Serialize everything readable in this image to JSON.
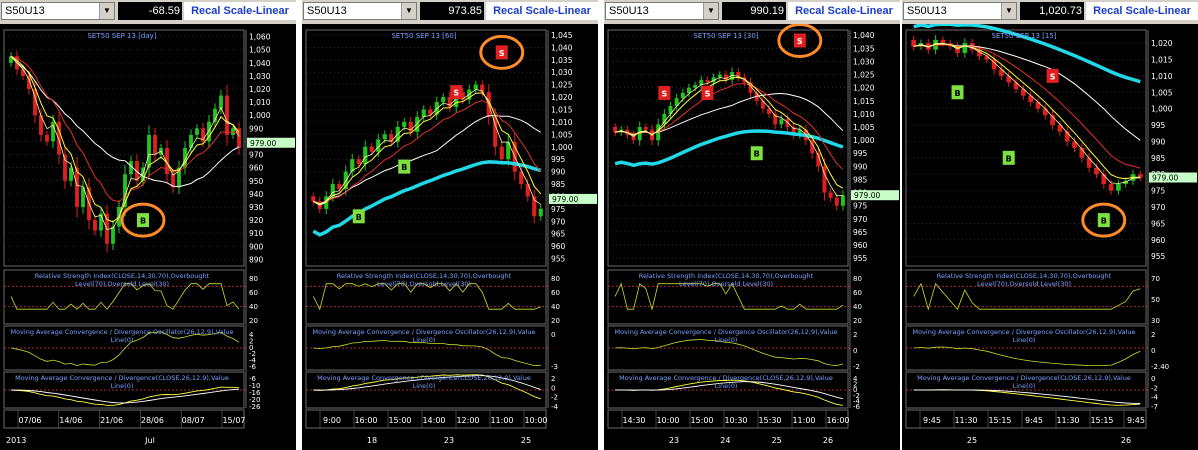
{
  "panels": [
    {
      "symbol": "S50U13",
      "value": "-68.59",
      "recal": "Recal Scale-Linear",
      "title": "SET50 SEP 13  [day]",
      "price_ticks": [
        "1,060",
        "1,050",
        "1,040",
        "1,030",
        "1,020",
        "1,010",
        "1,000",
        "990",
        "980",
        "970",
        "960",
        "950",
        "940",
        "930",
        "920",
        "910",
        "900",
        "890"
      ],
      "price_tag": "979.00",
      "rsi_label": [
        "Relative Strength Index(CLOSE,14,30,70),Overbought",
        "Level(70),Oversold Level(30)"
      ],
      "rsi_ticks": [
        "80",
        "60",
        "40",
        "20"
      ],
      "osc_label": [
        "Moving Average Convergence / Divergence Oscillator(26,12,9),Value",
        "Line(0)"
      ],
      "osc_ticks": [
        "4",
        "2",
        "0",
        "-2",
        "-4",
        "-6"
      ],
      "macd_label": [
        "Moving Average Convergence / Divergence(CLOSE,26,12,9),Value",
        "Line(0)"
      ],
      "macd_ticks": [
        "-6",
        "-10",
        "-16",
        "-20",
        "-26"
      ],
      "date_ticks": [
        "07/06",
        "14/06",
        "21/06",
        "28/06",
        "08/07",
        "15/07"
      ],
      "period_labels": [
        "Jul"
      ],
      "corner_label": "2013",
      "signals": [
        {
          "type": "B",
          "label": "B",
          "circled": true
        }
      ]
    },
    {
      "symbol": "S50U13",
      "value": "973.85",
      "recal": "Recal Scale-Linear",
      "title": "SET50 SEP 13  [60]",
      "price_ticks": [
        "1,045",
        "1,040",
        "1,035",
        "1,030",
        "1,025",
        "1,020",
        "1,015",
        "1,010",
        "1,005",
        "1,000",
        "995",
        "990",
        "985",
        "980",
        "975",
        "970",
        "965",
        "960",
        "955"
      ],
      "price_tag": "979.00",
      "rsi_label": [
        "Relative Strength Index(CLOSE,14,30,70),Overbought",
        "Level(70),Oversold Level(30)"
      ],
      "rsi_ticks": [
        "80",
        "60",
        "40",
        "20"
      ],
      "osc_label": [
        "Moving Average Convergence / Divergence Oscillator(26,12,9),Value",
        "Line(0)"
      ],
      "osc_ticks": [
        "0",
        "-3"
      ],
      "macd_label": [
        "Moving Average Convergence / Divergence(CLOSE,26,12,9),Value",
        "Line(0)"
      ],
      "macd_ticks": [
        "2",
        "0",
        "-2",
        "-4"
      ],
      "date_ticks": [
        "9:00",
        "16:00",
        "15:00",
        "14:00",
        "12:00",
        "11:00",
        "10:00"
      ],
      "period_labels": [
        "18",
        "23",
        "25"
      ],
      "corner_label": "",
      "signals": [
        {
          "type": "B",
          "label": "B"
        },
        {
          "type": "B",
          "label": "B"
        },
        {
          "type": "S",
          "label": "S"
        },
        {
          "type": "S",
          "label": "S",
          "circled": true
        }
      ]
    },
    {
      "symbol": "S50U13",
      "value": "990.19",
      "recal": "Recal Scale-Linear",
      "title": "SET50 SEP 13  [30]",
      "price_ticks": [
        "1,040",
        "1,035",
        "1,030",
        "1,025",
        "1,020",
        "1,015",
        "1,010",
        "1,005",
        "1,000",
        "995",
        "990",
        "985",
        "980",
        "975",
        "970",
        "965",
        "960",
        "955"
      ],
      "price_tag": "979.00",
      "rsi_label": [
        "Relative Strength Index(CLOSE,14,30,70),Overbought",
        "Level(70),Oversold Level(30)"
      ],
      "rsi_ticks": [
        "80",
        "60",
        "40",
        "20"
      ],
      "osc_label": [
        "Moving Average Convergence / Divergence Oscillator(26,12,9),Value",
        "Line(0)"
      ],
      "osc_ticks": [
        "2",
        "0",
        "-2"
      ],
      "macd_label": [
        "Moving Average Convergence / Divergence(CLOSE,26,12,9),Value",
        "Line(0)"
      ],
      "macd_ticks": [
        "4",
        "2",
        "0",
        "-2",
        "-4",
        "-6"
      ],
      "date_ticks": [
        "14:30",
        "10:00",
        "15:00",
        "10:30",
        "15:30",
        "11:00",
        "16:00"
      ],
      "period_labels": [
        "23",
        "24",
        "25",
        "26"
      ],
      "corner_label": "",
      "signals": [
        {
          "type": "S",
          "label": "S"
        },
        {
          "type": "S",
          "label": "S"
        },
        {
          "type": "B",
          "label": "B"
        },
        {
          "type": "S",
          "label": "S",
          "circled": true
        }
      ]
    },
    {
      "symbol": "S50U13",
      "value": "1,020.73",
      "recal": "Recal Scale-Linear",
      "title": "SET50 SEP 13  [15]",
      "price_ticks": [
        "1,020",
        "1,015",
        "1,010",
        "1,005",
        "1,000",
        "995",
        "990",
        "985",
        "980",
        "975",
        "970",
        "965",
        "960",
        "955"
      ],
      "price_tag": "979.00",
      "rsi_label": [
        "Relative Strength Index(CLOSE,14,30,70),Overbought",
        "Level(70),Oversold Level(30)"
      ],
      "rsi_ticks": [
        "70",
        "50",
        "30"
      ],
      "osc_label": [
        "Moving Average Convergence / Divergence Oscillator(26,12,9),Value",
        "Line(0)"
      ],
      "osc_ticks": [
        "2",
        "0",
        "-2.40"
      ],
      "macd_label": [
        "Moving Average Convergence / Divergence(CLOSE,26,12,9),Value",
        "Line(0)"
      ],
      "macd_ticks": [
        "0",
        "-2",
        "-4",
        "-7"
      ],
      "date_ticks": [
        "9:45",
        "11:30",
        "15:15",
        "9:45",
        "11:30",
        "15:15",
        "9:45"
      ],
      "period_labels": [
        "25",
        "26"
      ],
      "corner_label": "",
      "signals": [
        {
          "type": "B",
          "label": "B"
        },
        {
          "type": "B",
          "label": "B"
        },
        {
          "type": "S",
          "label": "S"
        },
        {
          "type": "B",
          "label": "B",
          "circled": true
        }
      ]
    }
  ],
  "colors": {
    "background": "#000000",
    "grid": "#5a5a5a",
    "up_candle": "#22c422",
    "down_candle": "#e02020",
    "ma_fast": "#ffff40",
    "ma_mid": "#ffffff",
    "ma_slow": "#e03030",
    "ma_long": "#20d8e8",
    "rsi_line": "#c8e028",
    "level_line": "#e04040",
    "label_text": "#7aa0ff",
    "tick_text": "#ffffff",
    "buy_badge": "#7ee040",
    "sell_badge": "#e02020",
    "circle": "#ff8a2a",
    "price_tag": "#c8ffc8"
  },
  "chart_data": [
    {
      "type": "candlestick",
      "title": "SET50 SEP 13  [day]",
      "ylim": [
        885,
        1065
      ],
      "y_ticks": [
        1060,
        1050,
        1040,
        1030,
        1020,
        1010,
        1000,
        990,
        980,
        970,
        960,
        950,
        940,
        930,
        920,
        910,
        900,
        890
      ],
      "last_price": 979,
      "date_ticks": [
        "07/06",
        "14/06",
        "21/06",
        "28/06",
        "08/07",
        "15/07"
      ],
      "closes": [
        1045,
        1035,
        1030,
        1020,
        1000,
        985,
        980,
        995,
        970,
        950,
        960,
        930,
        945,
        920,
        912,
        925,
        902,
        915,
        930,
        955,
        965,
        950,
        960,
        985,
        970,
        975,
        955,
        945,
        960,
        975,
        985,
        990,
        980,
        995,
        1005,
        1015,
        985,
        990,
        975
      ],
      "indicators": [
        "RSI(CLOSE,14,30,70)",
        "MACD Oscillator(26,12,9)",
        "MACD(CLOSE,26,12,9)"
      ],
      "signals": [
        {
          "type": "B",
          "x_index": 22,
          "price": 920
        }
      ]
    },
    {
      "type": "candlestick",
      "title": "SET50 SEP 13  [60]",
      "ylim": [
        952,
        1047
      ],
      "y_ticks": [
        1045,
        1040,
        1035,
        1030,
        1025,
        1020,
        1015,
        1010,
        1005,
        1000,
        995,
        990,
        985,
        980,
        975,
        970,
        965,
        960,
        955
      ],
      "last_price": 979,
      "date_ticks": [
        "9:00",
        "16:00",
        "15:00",
        "14:00",
        "12:00",
        "11:00",
        "10:00"
      ],
      "period_labels": [
        "18",
        "23",
        "25"
      ],
      "closes": [
        978,
        975,
        980,
        985,
        983,
        990,
        995,
        993,
        1000,
        998,
        1003,
        1005,
        1002,
        1008,
        1010,
        1006,
        1012,
        1015,
        1013,
        1018,
        1020,
        1016,
        1022,
        1019,
        1023,
        1025,
        1022,
        1012,
        1000,
        995,
        1002,
        990,
        985,
        980,
        972,
        975
      ],
      "signals": [
        {
          "type": "B",
          "price": 972
        },
        {
          "type": "B",
          "price": 992
        },
        {
          "type": "S",
          "price": 1022
        },
        {
          "type": "S",
          "price": 1038
        }
      ]
    },
    {
      "type": "candlestick",
      "title": "SET50 SEP 13  [30]",
      "ylim": [
        952,
        1042
      ],
      "y_ticks": [
        1040,
        1035,
        1030,
        1025,
        1020,
        1015,
        1010,
        1005,
        1000,
        995,
        990,
        985,
        980,
        975,
        970,
        965,
        960,
        955
      ],
      "last_price": 979,
      "date_ticks": [
        "14:30",
        "10:00",
        "15:00",
        "10:30",
        "15:30",
        "11:00",
        "16:00"
      ],
      "period_labels": [
        "23",
        "24",
        "25",
        "26"
      ],
      "closes": [
        1003,
        1004,
        1002,
        1000,
        1005,
        1004,
        1000,
        1006,
        1010,
        1013,
        1016,
        1018,
        1020,
        1021,
        1023,
        1022,
        1024,
        1025,
        1023,
        1026,
        1024,
        1022,
        1018,
        1015,
        1012,
        1010,
        1006,
        1008,
        1005,
        1002,
        1004,
        1000,
        995,
        990,
        980,
        978,
        975,
        979
      ],
      "signals": [
        {
          "type": "S",
          "price": 1018
        },
        {
          "type": "S",
          "price": 1018
        },
        {
          "type": "B",
          "price": 995
        },
        {
          "type": "S",
          "price": 1038
        }
      ]
    },
    {
      "type": "candlestick",
      "title": "SET50 SEP 13  [15]",
      "ylim": [
        952,
        1024
      ],
      "y_ticks": [
        1020,
        1015,
        1010,
        1005,
        1000,
        995,
        990,
        985,
        980,
        975,
        970,
        965,
        960,
        955
      ],
      "last_price": 979,
      "date_ticks": [
        "9:45",
        "11:30",
        "15:15",
        "9:45",
        "11:30",
        "15:15",
        "9:45"
      ],
      "period_labels": [
        "25",
        "26"
      ],
      "closes": [
        1019,
        1020,
        1018,
        1021,
        1020,
        1019,
        1017,
        1020,
        1018,
        1016,
        1015,
        1012,
        1010,
        1008,
        1006,
        1004,
        1002,
        1000,
        998,
        995,
        993,
        990,
        988,
        985,
        982,
        980,
        977,
        975,
        977,
        978,
        980,
        979
      ],
      "signals": [
        {
          "type": "B",
          "price": 1005
        },
        {
          "type": "B",
          "price": 985
        },
        {
          "type": "S",
          "price": 1010
        },
        {
          "type": "B",
          "price": 966
        }
      ]
    }
  ]
}
